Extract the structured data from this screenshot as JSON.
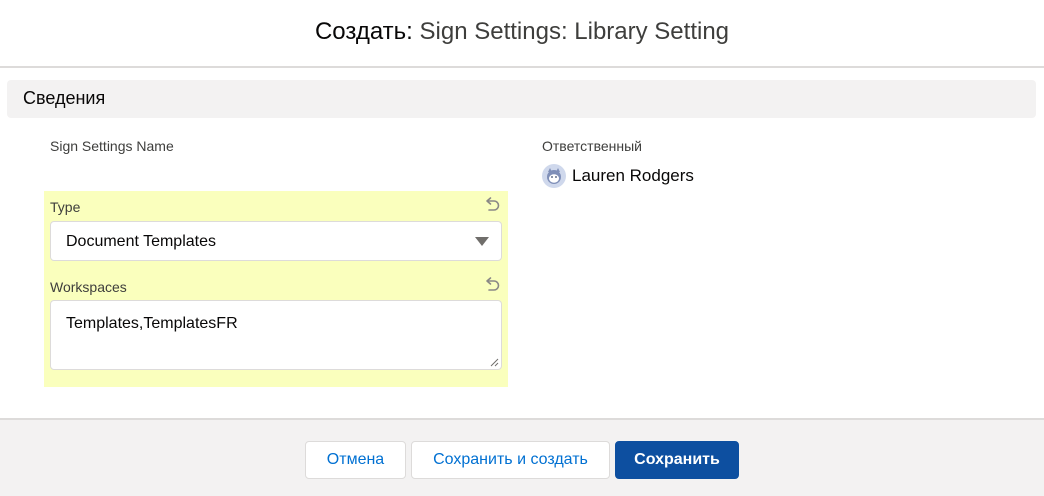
{
  "modal": {
    "title_action": "Создать",
    "title_separator": ": ",
    "title_object": "Sign Settings: Library Setting"
  },
  "section": {
    "title": "Сведения"
  },
  "fields": {
    "name_label": "Sign Settings Name",
    "owner_label": "Ответственный",
    "owner_name": "Lauren Rodgers",
    "type_label": "Type",
    "type_value": "Document Templates",
    "workspaces_label": "Workspaces",
    "workspaces_value": "Templates,TemplatesFR"
  },
  "buttons": {
    "cancel": "Отмена",
    "save_new": "Сохранить и создать",
    "save": "Сохранить"
  },
  "colors": {
    "brand_button": "#0d4fa0",
    "highlight": "#faffbd",
    "link": "#0070d2"
  }
}
